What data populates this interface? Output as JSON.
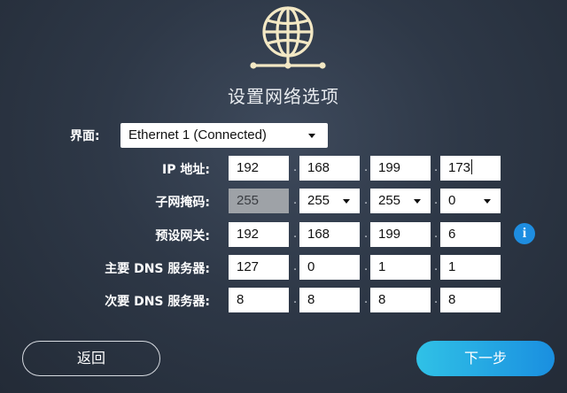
{
  "title": "设置网络选项",
  "interface": {
    "label": "界面:",
    "selected": "Ethernet 1 (Connected)"
  },
  "rows": [
    {
      "label": "IP 地址:",
      "values": [
        "192",
        "168",
        "199",
        "173"
      ]
    },
    {
      "label": "子网掩码:",
      "values": [
        "255",
        "255",
        "255",
        "0"
      ]
    },
    {
      "label": "预设网关:",
      "values": [
        "192",
        "168",
        "199",
        "6"
      ]
    },
    {
      "label": "主要 DNS 服务器:",
      "values": [
        "127",
        "0",
        "1",
        "1"
      ]
    },
    {
      "label": "次要 DNS 服务器:",
      "values": [
        "8",
        "8",
        "8",
        "8"
      ]
    }
  ],
  "separator": ".",
  "info_glyph": "i",
  "buttons": {
    "back": "返回",
    "next": "下一步"
  },
  "icons": {
    "network": "globe-network-icon",
    "info": "info-icon",
    "dropdown": "caret-down-icon"
  },
  "colors": {
    "accent_start": "#30c1e6",
    "accent_end": "#1a8fe0",
    "info": "#1e8de0",
    "disabled_field": "#9ea2a7"
  }
}
